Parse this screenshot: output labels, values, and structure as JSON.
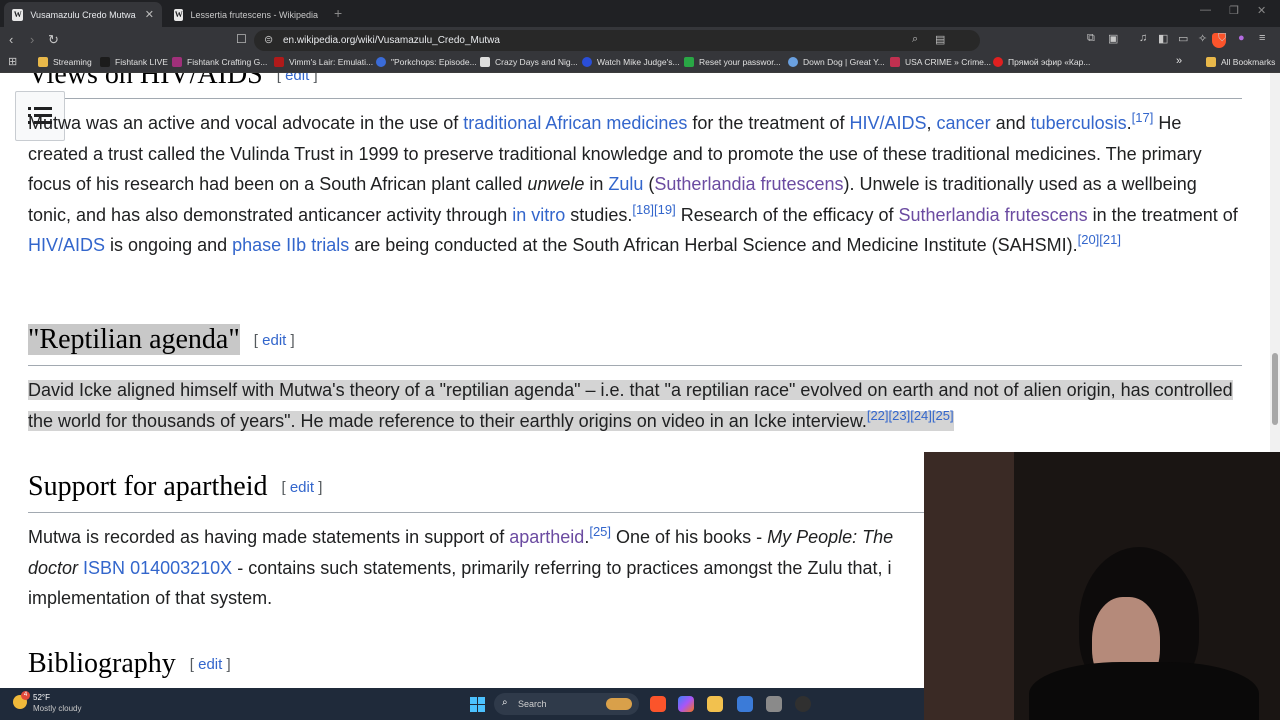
{
  "browser": {
    "tabs": [
      {
        "title": "Vusamazulu Credo Mutwa - Wiki",
        "favicon": "W",
        "active": true
      },
      {
        "title": "Lessertia frutescens - Wikipedia",
        "favicon": "W",
        "active": false
      }
    ],
    "url": "en.wikipedia.org/wiki/Vusamazulu_Credo_Mutwa",
    "bookmarks": [
      {
        "label": "Streaming",
        "color": "#e8b84a"
      },
      {
        "label": "Fishtank LIVE",
        "color": "#1c1c1c"
      },
      {
        "label": "Fishtank Crafting G...",
        "color": "#a0307a"
      },
      {
        "label": "Vimm's Lair: Emulati...",
        "color": "#b01a1a"
      },
      {
        "label": "\"Porkchops: Episode...",
        "color": "#3a6bd8"
      },
      {
        "label": "Crazy Days and Nig...",
        "color": "#dddddd"
      },
      {
        "label": "Watch Mike Judge's...",
        "color": "#2a4ed8"
      },
      {
        "label": "Reset your passwor...",
        "color": "#29a745"
      },
      {
        "label": "Down Dog | Great Y...",
        "color": "#6aa0e0"
      },
      {
        "label": "USA CRIME » Crime...",
        "color": "#c03050"
      },
      {
        "label": "Прямой эфир «Кар...",
        "color": "#e02020"
      }
    ],
    "more_bookmarks": "»",
    "all_bookmarks": "All Bookmarks"
  },
  "article": {
    "s1": {
      "heading": "Views on HIV/AIDS",
      "edit": "edit",
      "p": {
        "t1": "Mutwa was an active and vocal advocate in the use of ",
        "l1": "traditional African medicines",
        "t2": " for the treatment of ",
        "l2": "HIV/AIDS",
        "t3": ", ",
        "l3": "cancer",
        "t4": " and ",
        "l4": "tuberculosis",
        "t5": ".",
        "r1": "[17]",
        "t6": " He created a trust called the Vulinda Trust in 1999 to preserve traditional knowledge and to promote the use of these traditional medicines. The primary focus of his research had been on a South African plant called ",
        "em1": "unwele",
        "t7": " in ",
        "l5": "Zulu",
        "t8": " (",
        "l6": "Sutherlandia frutescens",
        "t9": "). Unwele is traditionally used as a wellbeing tonic, and has also demonstrated anticancer activity through ",
        "l7": "in vitro",
        "t10": " studies.",
        "r2": "[18]",
        "r3": "[19]",
        "t11": " Research of the efficacy of ",
        "l8": "Sutherlandia frutescens",
        "t12": " in the treatment of ",
        "l9": "HIV/AIDS",
        "t13": " is ongoing and ",
        "l10": "phase IIb trials",
        "t14": " are being conducted at the South African Herbal Science and Medicine Institute (SAHSMI).",
        "r4": "[20]",
        "r5": "[21]"
      }
    },
    "s2": {
      "heading": "\"Reptilian agenda\"",
      "edit": "edit",
      "p": {
        "t1": "David Icke aligned himself with Mutwa's theory of a \"reptilian agenda\" – i.e. that \"a reptilian race\" evolved on earth and not of alien origin, has controlled the world for thousands of years\". He made reference to their earthly origins on video in an Icke interview.",
        "r1": "[22]",
        "r2": "[23]",
        "r3": "[24]",
        "r4": "[25]"
      }
    },
    "s3": {
      "heading": "Support for apartheid",
      "edit": "edit",
      "p": {
        "t1": "Mutwa is recorded as having made statements in support of ",
        "l1": "apartheid",
        "t2": ".",
        "r1": "[25]",
        "t3": " One of his books - ",
        "em1": "My People: The",
        "t4": " ",
        "em2": "doctor",
        "t5": " ",
        "l2": "ISBN",
        "t6": " ",
        "l3": "014003210X",
        "t7": " - contains such statements, primarily referring to practices amongst the Zulu that, i",
        "t8": " implementation of that system."
      }
    },
    "s4": {
      "heading": "Bibliography",
      "edit": "edit"
    }
  },
  "taskbar": {
    "temperature": "52°F",
    "condition": "Mostly cloudy",
    "search_placeholder": "Search",
    "weather_badge": "4"
  }
}
